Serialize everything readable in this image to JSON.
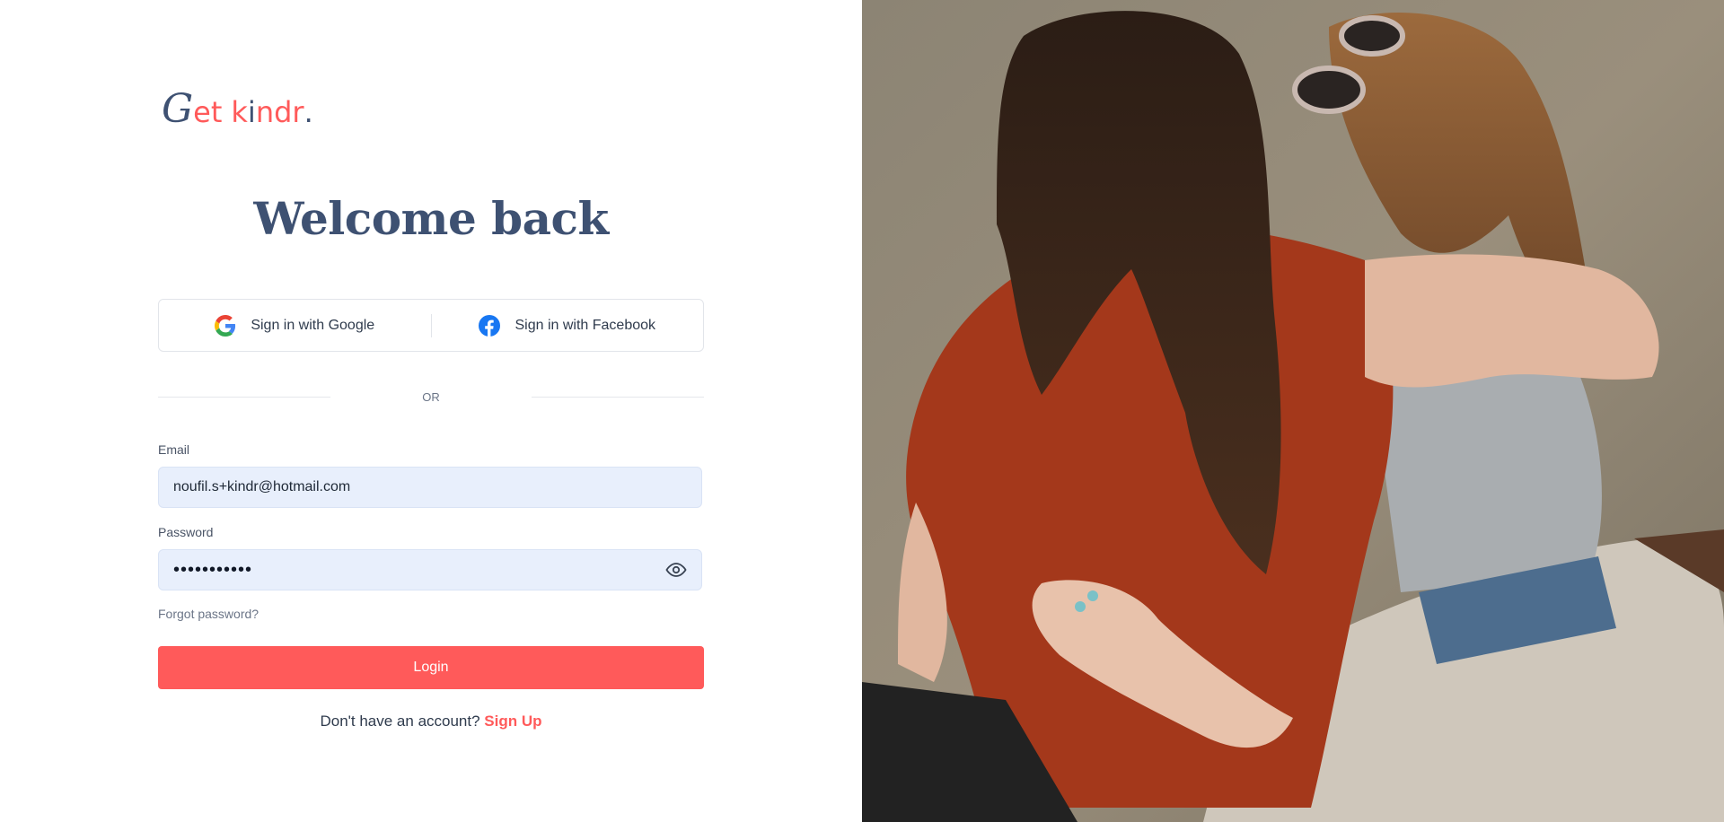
{
  "brand": {
    "logo_g": "G",
    "logo_et": "et",
    "logo_k": "k",
    "logo_i": "i",
    "logo_ndr": "ndr",
    "logo_dot": "."
  },
  "login": {
    "heading": "Welcome back",
    "google_label": "Sign in with Google",
    "facebook_label": "Sign in with Facebook",
    "or_text": "OR",
    "email_label": "Email",
    "email_value": "noufil.s+kindr@hotmail.com",
    "password_label": "Password",
    "password_value": "•••••••••••",
    "forgot_label": "Forgot password?",
    "login_button": "Login",
    "signup_prompt": "Don't have an account?",
    "signup_link": "Sign Up"
  },
  "colors": {
    "accent": "#ff5a5a",
    "heading": "#3e5172",
    "input_bg": "#e8effc",
    "facebook": "#1877f2"
  },
  "icons": {
    "google": "google-icon",
    "facebook": "facebook-icon",
    "eye": "eye-icon"
  }
}
